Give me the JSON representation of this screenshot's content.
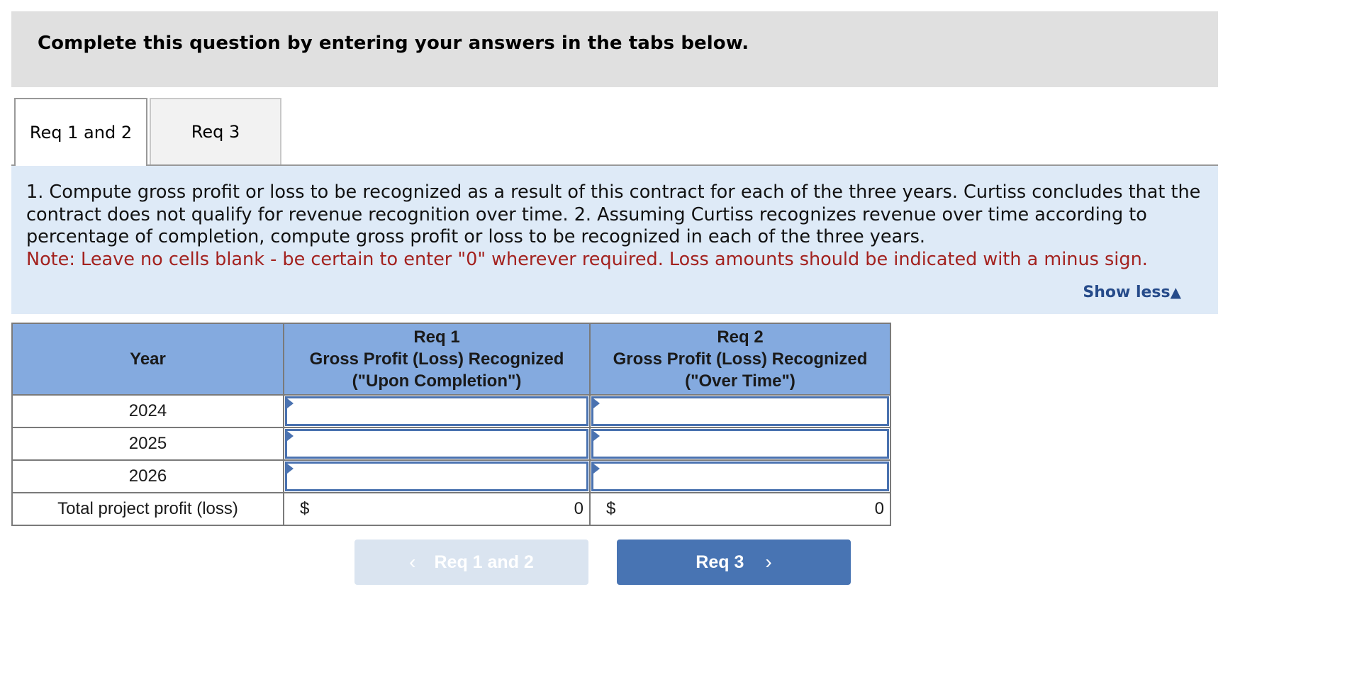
{
  "banner": {
    "title": "Complete this question by entering your answers in the tabs below."
  },
  "tabs": [
    {
      "label": "Req 1 and 2",
      "active": true
    },
    {
      "label": "Req 3",
      "active": false
    }
  ],
  "instructions": {
    "text": "1. Compute gross profit or loss to be recognized as a result of this contract for each of the three years. Curtiss concludes that the contract does not qualify for revenue recognition over time. 2. Assuming Curtiss recognizes revenue over time according to percentage of completion, compute gross profit or loss to be recognized in each of the three years.",
    "note": "Note: Leave no cells blank - be certain to enter \"0\" wherever required. Loss amounts should be indicated with a minus sign.",
    "toggle_label": "Show less",
    "toggle_icon": "▲"
  },
  "table": {
    "headers": {
      "year": "Year",
      "col1": {
        "line1": "Req 1",
        "line2": "Gross Profit (Loss) Recognized",
        "line3": "(\"Upon Completion\")"
      },
      "col2": {
        "line1": "Req 2",
        "line2": "Gross Profit (Loss) Recognized",
        "line3": "(\"Over Time\")"
      }
    },
    "rows": [
      {
        "year": "2024",
        "col1": "",
        "col2": ""
      },
      {
        "year": "2025",
        "col1": "",
        "col2": ""
      },
      {
        "year": "2026",
        "col1": "",
        "col2": ""
      }
    ],
    "total": {
      "label": "Total project profit (loss)",
      "col1_currency": "$",
      "col1_value": "0",
      "col2_currency": "$",
      "col2_value": "0"
    }
  },
  "nav": {
    "prev_label": "Req 1 and 2",
    "prev_icon": "‹",
    "next_label": "Req 3",
    "next_icon": "›"
  },
  "colors": {
    "header_bg": "#84aadf",
    "panel_bg": "#deeaf7",
    "note_red": "#a3221f",
    "link_blue": "#264b8a",
    "next_btn": "#4874b3",
    "prev_btn_disabled": "#dae4f0"
  }
}
